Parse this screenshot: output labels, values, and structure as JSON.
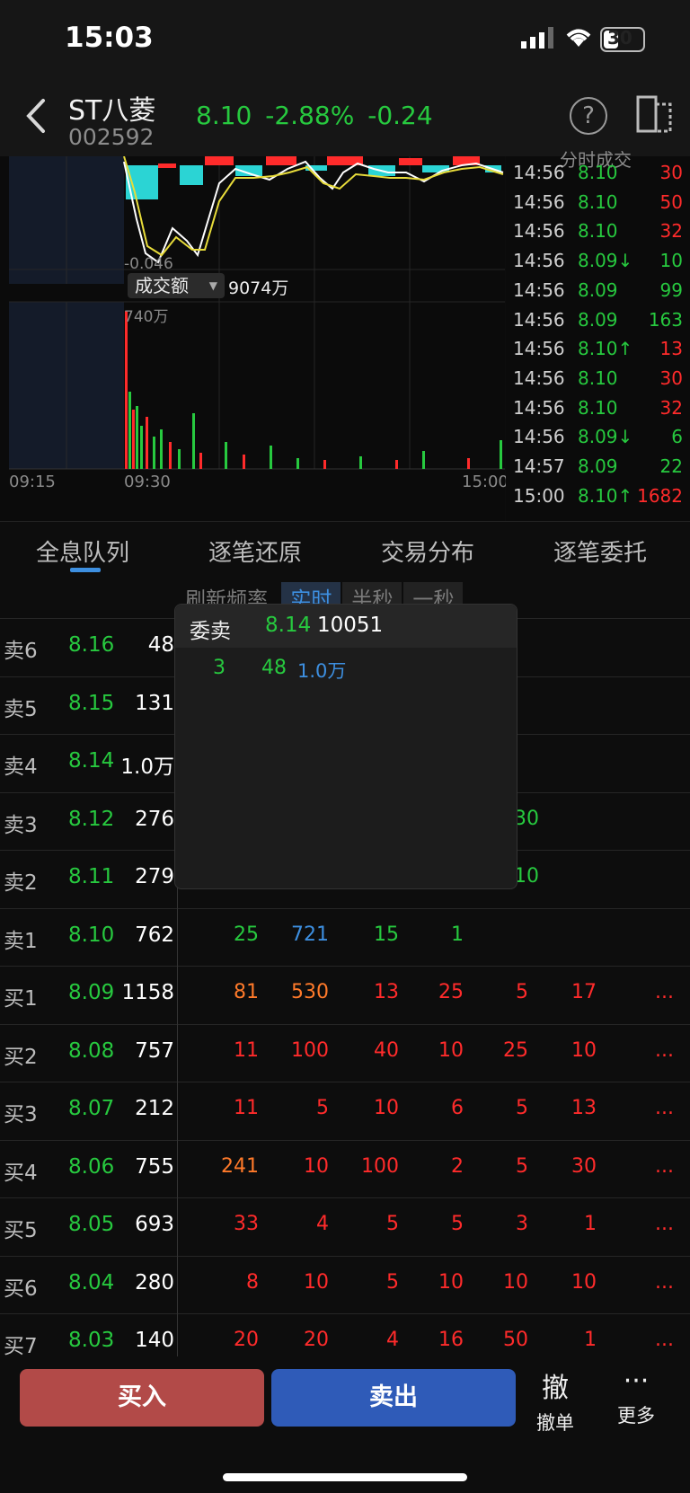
{
  "status_bar": {
    "time": "15:03",
    "battery": "30"
  },
  "header": {
    "name": "ST八菱",
    "code": "002592",
    "price": "8.10",
    "change_pct": "-2.88%",
    "change": "-0.24",
    "help_label": "?"
  },
  "chart": {
    "price_low_label": "-0.046",
    "turnover_label": "成交额",
    "turnover_value": "9074万",
    "volume_max_label": "740万",
    "x_labels": {
      "start": "09:15",
      "open": "09:30",
      "end": "15:00"
    },
    "trade_list_title": "分时成交"
  },
  "trades": [
    {
      "time": "14:56",
      "price": "8.10",
      "vol": "30",
      "pc": "green",
      "vc": "red"
    },
    {
      "time": "14:56",
      "price": "8.10",
      "vol": "50",
      "pc": "green",
      "vc": "red"
    },
    {
      "time": "14:56",
      "price": "8.10",
      "vol": "32",
      "pc": "green",
      "vc": "red"
    },
    {
      "time": "14:56",
      "price": "8.09↓",
      "vol": "10",
      "pc": "green",
      "vc": "green"
    },
    {
      "time": "14:56",
      "price": "8.09",
      "vol": "99",
      "pc": "green",
      "vc": "green"
    },
    {
      "time": "14:56",
      "price": "8.09",
      "vol": "163",
      "pc": "green",
      "vc": "green"
    },
    {
      "time": "14:56",
      "price": "8.10↑",
      "vol": "13",
      "pc": "green",
      "vc": "red"
    },
    {
      "time": "14:56",
      "price": "8.10",
      "vol": "30",
      "pc": "green",
      "vc": "red"
    },
    {
      "time": "14:56",
      "price": "8.10",
      "vol": "32",
      "pc": "green",
      "vc": "red"
    },
    {
      "time": "14:56",
      "price": "8.09↓",
      "vol": "6",
      "pc": "green",
      "vc": "green"
    },
    {
      "time": "14:57",
      "price": "8.09",
      "vol": "22",
      "pc": "green",
      "vc": "green"
    },
    {
      "time": "15:00",
      "price": "8.10↑",
      "vol": "1682",
      "pc": "green",
      "vc": "red"
    }
  ],
  "tabs": [
    "全息队列",
    "逐笔还原",
    "交易分布",
    "逐笔委托"
  ],
  "freq": {
    "label": "刷新频率",
    "options": [
      "实时",
      "半秒",
      "一秒"
    ]
  },
  "popup": {
    "title": "委卖",
    "price": "8.14",
    "total": "10051",
    "row": [
      "3",
      "48",
      "1.0万"
    ]
  },
  "book": [
    {
      "label": "卖6",
      "price": "8.16",
      "vol": "48",
      "queue": []
    },
    {
      "label": "卖5",
      "price": "8.15",
      "vol": "131",
      "queue": []
    },
    {
      "label": "卖4",
      "price": "8.14",
      "vol": "1.0万",
      "queue": []
    },
    {
      "label": "卖3",
      "price": "8.12",
      "vol": "276",
      "queue": [
        {
          "v": "30",
          "c": "green"
        }
      ]
    },
    {
      "label": "卖2",
      "price": "8.11",
      "vol": "279",
      "queue": [
        {
          "v": "10",
          "c": "green"
        }
      ]
    },
    {
      "label": "卖1",
      "price": "8.10",
      "vol": "762",
      "queue": [
        {
          "v": "25",
          "c": "green"
        },
        {
          "v": "721",
          "c": "blue"
        },
        {
          "v": "15",
          "c": "green"
        },
        {
          "v": "1",
          "c": "green"
        }
      ]
    },
    {
      "label": "买1",
      "price": "8.09",
      "vol": "1158",
      "queue": [
        {
          "v": "81",
          "c": "orange"
        },
        {
          "v": "530",
          "c": "orange"
        },
        {
          "v": "13",
          "c": "red"
        },
        {
          "v": "25",
          "c": "red"
        },
        {
          "v": "5",
          "c": "red"
        },
        {
          "v": "17",
          "c": "red"
        },
        {
          "v": "...",
          "c": "red"
        }
      ]
    },
    {
      "label": "买2",
      "price": "8.08",
      "vol": "757",
      "queue": [
        {
          "v": "11",
          "c": "red"
        },
        {
          "v": "100",
          "c": "red"
        },
        {
          "v": "40",
          "c": "red"
        },
        {
          "v": "10",
          "c": "red"
        },
        {
          "v": "25",
          "c": "red"
        },
        {
          "v": "10",
          "c": "red"
        },
        {
          "v": "...",
          "c": "red"
        }
      ]
    },
    {
      "label": "买3",
      "price": "8.07",
      "vol": "212",
      "queue": [
        {
          "v": "11",
          "c": "red"
        },
        {
          "v": "5",
          "c": "red"
        },
        {
          "v": "10",
          "c": "red"
        },
        {
          "v": "6",
          "c": "red"
        },
        {
          "v": "5",
          "c": "red"
        },
        {
          "v": "13",
          "c": "red"
        },
        {
          "v": "...",
          "c": "red"
        }
      ]
    },
    {
      "label": "买4",
      "price": "8.06",
      "vol": "755",
      "queue": [
        {
          "v": "241",
          "c": "orange"
        },
        {
          "v": "10",
          "c": "red"
        },
        {
          "v": "100",
          "c": "red"
        },
        {
          "v": "2",
          "c": "red"
        },
        {
          "v": "5",
          "c": "red"
        },
        {
          "v": "30",
          "c": "red"
        },
        {
          "v": "...",
          "c": "red"
        }
      ]
    },
    {
      "label": "买5",
      "price": "8.05",
      "vol": "693",
      "queue": [
        {
          "v": "33",
          "c": "red"
        },
        {
          "v": "4",
          "c": "red"
        },
        {
          "v": "5",
          "c": "red"
        },
        {
          "v": "5",
          "c": "red"
        },
        {
          "v": "3",
          "c": "red"
        },
        {
          "v": "1",
          "c": "red"
        },
        {
          "v": "...",
          "c": "red"
        }
      ]
    },
    {
      "label": "买6",
      "price": "8.04",
      "vol": "280",
      "queue": [
        {
          "v": "8",
          "c": "red"
        },
        {
          "v": "10",
          "c": "red"
        },
        {
          "v": "5",
          "c": "red"
        },
        {
          "v": "10",
          "c": "red"
        },
        {
          "v": "10",
          "c": "red"
        },
        {
          "v": "10",
          "c": "red"
        },
        {
          "v": "...",
          "c": "red"
        }
      ]
    },
    {
      "label": "买7",
      "price": "8.03",
      "vol": "140",
      "queue": [
        {
          "v": "20",
          "c": "red"
        },
        {
          "v": "20",
          "c": "red"
        },
        {
          "v": "4",
          "c": "red"
        },
        {
          "v": "16",
          "c": "red"
        },
        {
          "v": "50",
          "c": "red"
        },
        {
          "v": "1",
          "c": "red"
        },
        {
          "v": "...",
          "c": "red"
        }
      ]
    }
  ],
  "actions": {
    "buy": "买入",
    "sell": "卖出",
    "cancel_glyph": "撤",
    "cancel": "撤单",
    "more": "更多"
  }
}
